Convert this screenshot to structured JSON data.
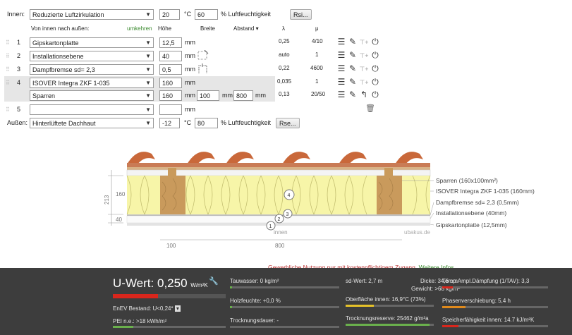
{
  "inside": {
    "label": "Innen:",
    "climate": "Reduzierte Luftzirkulation",
    "temp": "20",
    "temp_unit": "°C",
    "humidity": "60",
    "humidity_label": "% Luftfeuchtigkeit",
    "rsi_button": "Rsi..."
  },
  "header": {
    "order": "Von innen nach außen:",
    "reverse": "umkehren",
    "height": "Höhe",
    "width": "Breite",
    "spacing": "Abstand",
    "spacing_arrow": "▾",
    "lambda": "λ",
    "mu": "μ"
  },
  "layers": [
    {
      "num": "1",
      "material": "Gipskartonplatte",
      "thickness": "12,5",
      "unit": "mm",
      "lambda": "0,25",
      "mu": "4/10"
    },
    {
      "num": "2",
      "material": "Installationsebene",
      "thickness": "40",
      "unit": "mm",
      "lambda": "auto",
      "mu": "1"
    },
    {
      "num": "3",
      "material": "Dampfbremse sd= 2,3",
      "thickness": "0,5",
      "unit": "mm",
      "lambda": "0,22",
      "mu": "4600"
    },
    {
      "num": "4",
      "material": "ISOVER Integra ZKF 1-035",
      "thickness": "160",
      "unit": "mm",
      "lambda": "0,035",
      "mu": "1"
    },
    {
      "num": "",
      "material": "Sparren",
      "thickness": "160",
      "unit": "mm",
      "width": "100",
      "width_unit": "mm",
      "spacing": "800",
      "spacing_unit": "mm",
      "lambda": "0,13",
      "mu": "20/50"
    },
    {
      "num": "5",
      "material": "",
      "thickness": "",
      "unit": "mm",
      "lambda": "",
      "mu": ""
    }
  ],
  "outside": {
    "label": "Außen:",
    "climate": "Hinterlüftete Dachhaut",
    "temp": "-12",
    "temp_unit": "°C",
    "humidity": "80",
    "humidity_label": "% Luftfeuchtigkeit",
    "rse_button": "Rse..."
  },
  "icons": {
    "menu": "☰",
    "edit": "✎",
    "add": "⊤+",
    "power": "⏻",
    "undo": "↰",
    "trash": "🗑"
  },
  "diagram": {
    "dim_213": "213",
    "dim_160": "160",
    "dim_40": "40",
    "dim_100": "100",
    "dim_800": "800",
    "inside_label": "innen",
    "watermark": "ubakus.de",
    "circles": [
      "1",
      "2",
      "3",
      "4"
    ],
    "legend": [
      "Sparren (160x100mm²)",
      "ISOVER Integra ZKF 1-035 (160mm)",
      "Dampfbremse sd= 2,3 (0,5mm)",
      "Installationsebene (40mm)",
      "Gipskartonplatte (12,5mm)"
    ],
    "colors": {
      "insulation": "#f7f5a8",
      "wood": "#c99a5c",
      "tile": "#c9683a"
    }
  },
  "notice": {
    "text": "Gewerbliche Nutzung nur mit kostenpflichtigem Zugang.",
    "link": "Weitere Infos"
  },
  "results": {
    "u_label": "U-Wert:",
    "u_value": "0,250",
    "u_unit": "W/m²K",
    "enev": "EnEV Bestand: U<0,24*",
    "pei": "PEI n.e.: >18 kWh/m²",
    "tauwasser": "Tauwasser: 0 kg/m²",
    "holzfeuchte": "Holzfeuchte: +0,0 %",
    "trocknungsdauer": "Trocknungsdauer: -",
    "sd": "sd-Wert: 2,7 m",
    "dicke": "Dicke: 34,6 cm",
    "gewicht": "Gewicht: >68 kg/m²",
    "oberflaeche": "Oberfläche innen: 16,9°C (73%)",
    "trocknungsreserve": "Trocknungsreserve: 25462 g/m²a",
    "temp_amp": "Temp.Ampl.Dämpfung (1/TAV): 3,3",
    "phase": "Phasenverschiebung: 5,4 h",
    "speicher": "Speicherfähigkeit innen: 14.7 kJ/m²K"
  }
}
